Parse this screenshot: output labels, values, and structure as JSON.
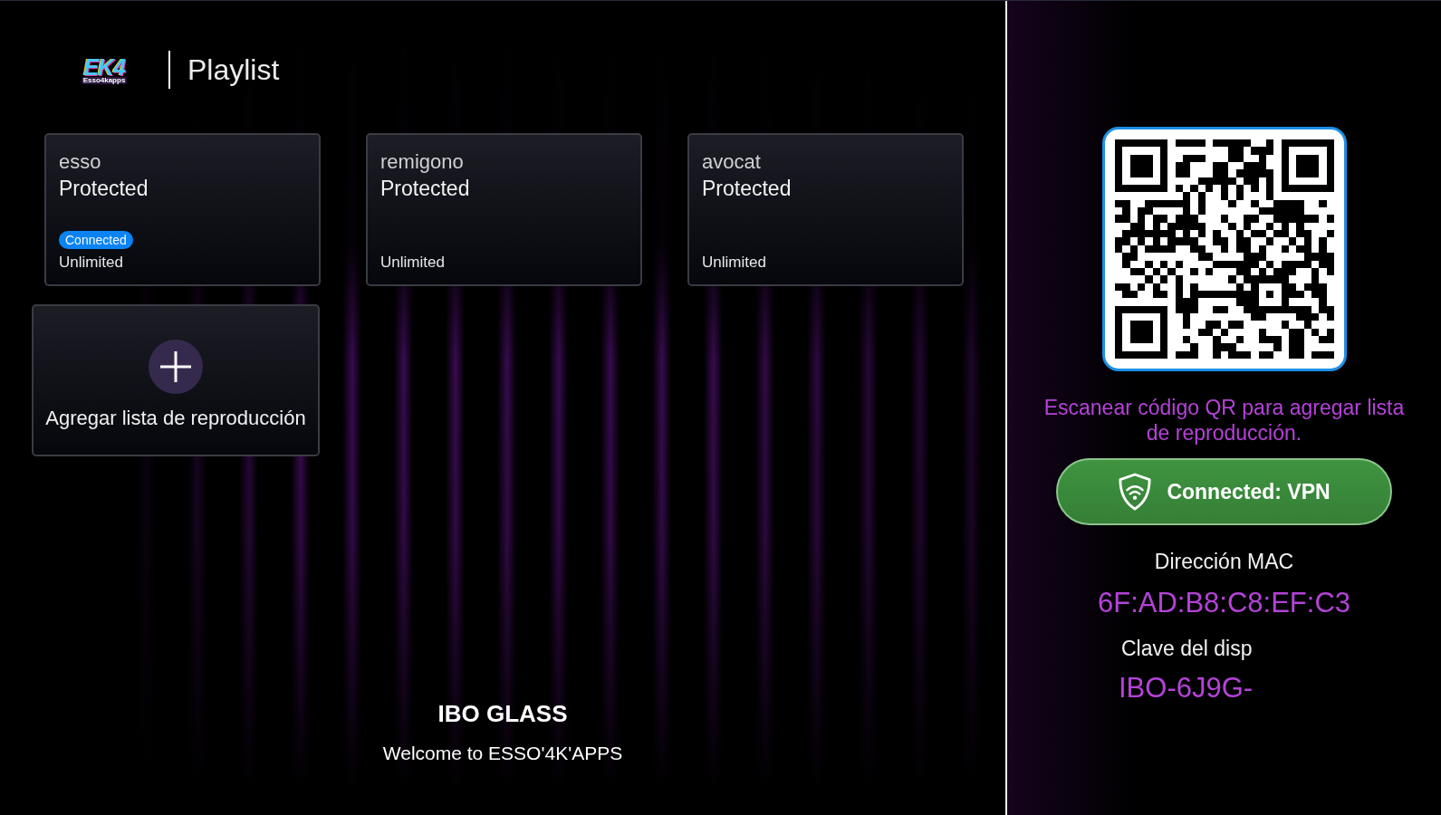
{
  "header": {
    "logo": {
      "mark": "EK4",
      "wordmark": "Esso4kapps"
    },
    "title": "Playlist"
  },
  "playlists": [
    {
      "name": "esso",
      "protection": "Protected",
      "badge": "Connected",
      "plan": "Unlimited"
    },
    {
      "name": "remigono",
      "protection": "Protected",
      "plan": "Unlimited"
    },
    {
      "name": "avocat",
      "protection": "Protected",
      "plan": "Unlimited"
    }
  ],
  "add_playlist": {
    "label": "Agregar lista de reproducción"
  },
  "footer": {
    "app_name": "IBO GLASS",
    "welcome": "Welcome to ESSO'4K'APPS"
  },
  "side_panel": {
    "qr_caption": "Escanear código QR para agregar lista de reproducción.",
    "vpn_button": {
      "label": "Connected: VPN"
    },
    "mac_label": "Dirección MAC",
    "mac_address": "6F:AD:B8:C8:EF:C3",
    "device_key_label": "Clave del disp",
    "device_key": "IBO-6J9G-"
  }
}
